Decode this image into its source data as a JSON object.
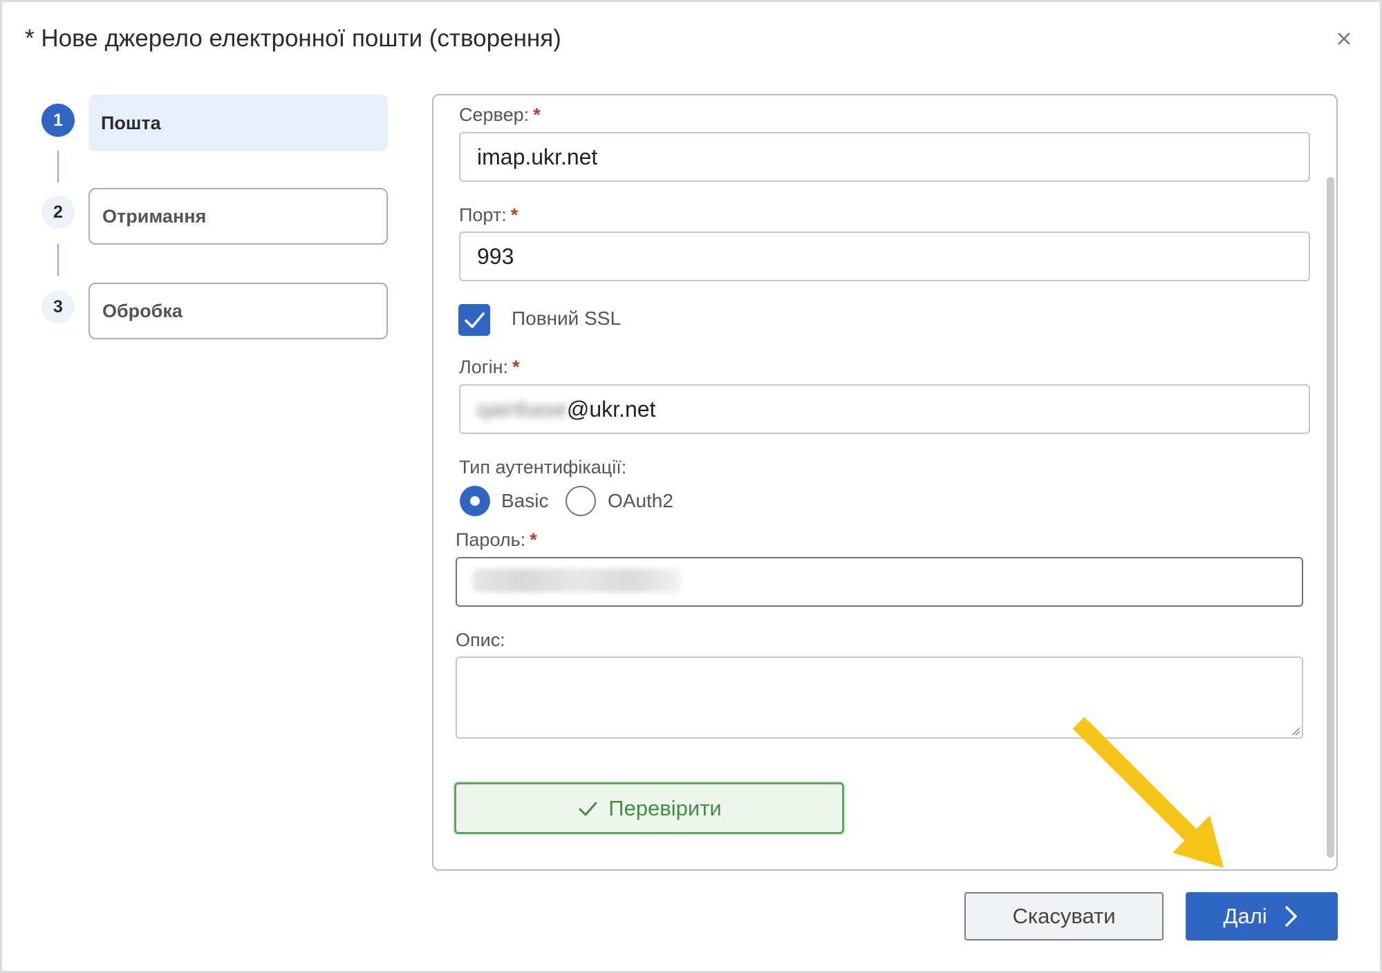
{
  "dialog": {
    "title": "* Нове джерело електронної пошти (створення)",
    "close_icon": "close-icon"
  },
  "steps": [
    {
      "number": "1",
      "label": "Пошта",
      "active": true
    },
    {
      "number": "2",
      "label": "Отримання",
      "active": false
    },
    {
      "number": "3",
      "label": "Обробка",
      "active": false
    }
  ],
  "form": {
    "server": {
      "label": "Сервер:",
      "required_mark": "*",
      "value": "imap.ukr.net"
    },
    "port": {
      "label": "Порт:",
      "required_mark": "*",
      "value": "993"
    },
    "ssl": {
      "label": "Повний SSL",
      "checked": true
    },
    "login": {
      "label": "Логін:",
      "required_mark": "*",
      "value_hidden_part": "qainbase",
      "value_domain": "@ukr.net"
    },
    "auth_type": {
      "label": "Тип аутентифікації:",
      "options": [
        {
          "label": "Basic",
          "selected": true
        },
        {
          "label": "OAuth2",
          "selected": false
        }
      ]
    },
    "password": {
      "label": "Пароль:",
      "required_mark": "*"
    },
    "description": {
      "label": "Опис:",
      "value": ""
    },
    "verify_button": "Перевірити"
  },
  "footer": {
    "cancel_label": "Скасувати",
    "next_label": "Далі"
  },
  "colors": {
    "primary": "#2f66c4",
    "success": "#3f8f3f",
    "required": "#c0392b",
    "annotation_arrow": "#f5c518"
  }
}
